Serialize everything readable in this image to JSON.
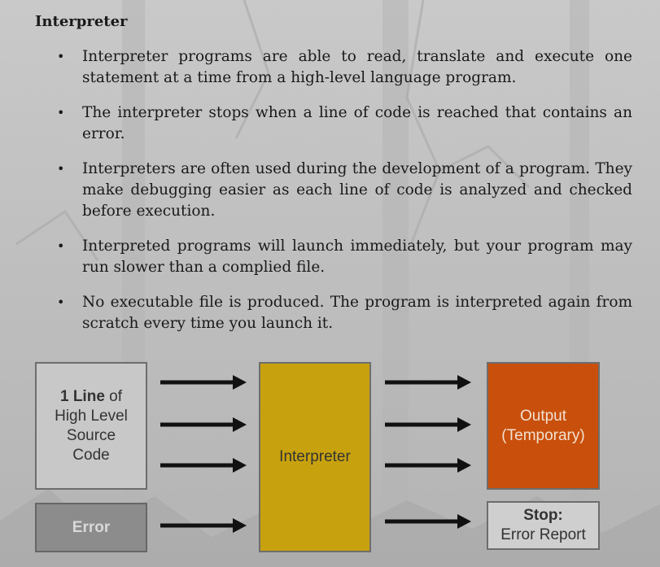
{
  "heading": "Interpreter",
  "bullets": [
    "Interpreter programs are able to read, translate and execute one statement at a time from a high-level language program.",
    "The interpreter stops when a line of code is reached that contains an error.",
    "Interpreters are often used during the development of a program.  They make debugging easier as each line of code is analyzed and checked before execution.",
    "Interpreted programs will launch immediately, but your program may run slower than a complied file.",
    "No executable file is produced.  The program is interpreted again from scratch every time you launch it."
  ],
  "diagram": {
    "source_bold": "1 Line",
    "source_rest": " of",
    "source_line2": "High Level",
    "source_line3": "Source",
    "source_line4": "Code",
    "error_label": "Error",
    "interpreter_label": "Interpreter",
    "output_line1": "Output",
    "output_line2": "(Temporary)",
    "stop_bold": "Stop:",
    "stop_line2": "Error Report",
    "colors": {
      "source_box": "#c8c8c8",
      "error_box": "#8c8c8c",
      "interpreter_box": "#c8a20e",
      "output_box": "#c8500c",
      "stop_box": "#cfcfcf",
      "arrow": "#111111"
    }
  }
}
